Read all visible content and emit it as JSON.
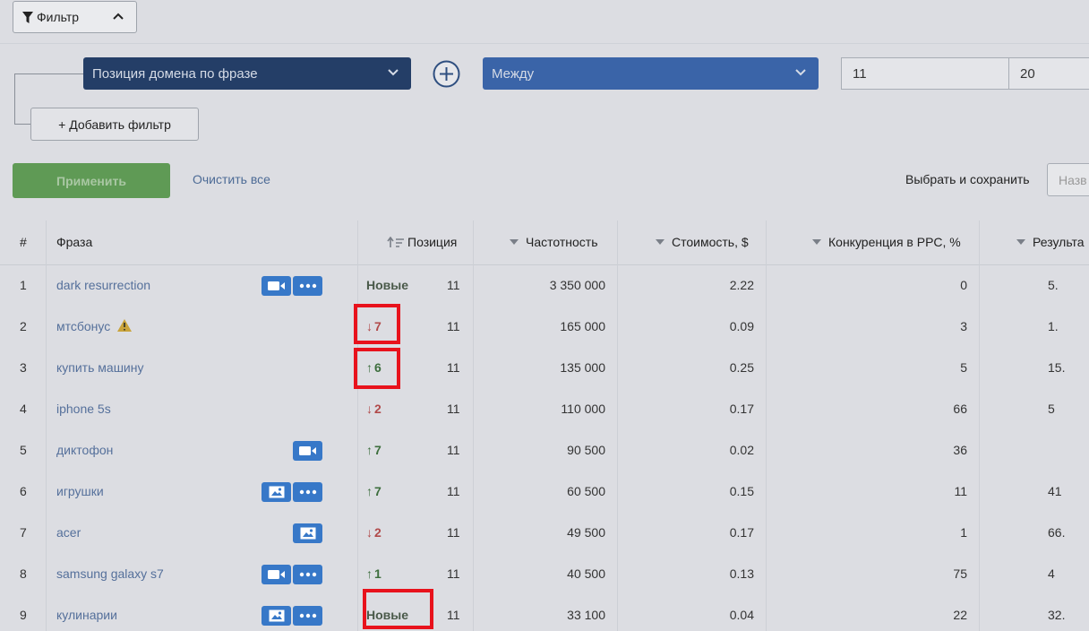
{
  "filter": {
    "toggle_label": "Фильтр",
    "condition_field": "Позиция домена по фразе",
    "operator": "Между",
    "value_from": "11",
    "value_to": "20",
    "add_filter_label": "+ Добавить фильтр",
    "apply_label": "Применить",
    "clear_label": "Очистить все",
    "choose_save_label": "Выбрать и сохранить",
    "name_placeholder": "Назв"
  },
  "table": {
    "headers": {
      "num": "#",
      "phrase": "Фраза",
      "position": "Позиция",
      "frequency": "Частотность",
      "cost": "Стоимость, $",
      "competition": "Конкуренция в PPC, %",
      "results": "Результа"
    },
    "rows": [
      {
        "num": "1",
        "phrase": "dark resurrection",
        "change": "Новые",
        "change_type": "new",
        "position": "11",
        "frequency": "3 350 000",
        "cost": "2.22",
        "competition": "0",
        "results": "5.",
        "badges": [
          "video",
          "more"
        ]
      },
      {
        "num": "2",
        "phrase": "мтсбонус",
        "change": "7",
        "change_type": "down",
        "position": "11",
        "frequency": "165 000",
        "cost": "0.09",
        "competition": "3",
        "results": "1.",
        "badges": [],
        "warning": true
      },
      {
        "num": "3",
        "phrase": "купить машину",
        "change": "6",
        "change_type": "up",
        "position": "11",
        "frequency": "135 000",
        "cost": "0.25",
        "competition": "5",
        "results": "15.",
        "badges": []
      },
      {
        "num": "4",
        "phrase": "iphone 5s",
        "change": "2",
        "change_type": "down",
        "position": "11",
        "frequency": "110 000",
        "cost": "0.17",
        "competition": "66",
        "results": "5",
        "badges": []
      },
      {
        "num": "5",
        "phrase": "диктофон",
        "change": "7",
        "change_type": "up",
        "position": "11",
        "frequency": "90 500",
        "cost": "0.02",
        "competition": "36",
        "results": "",
        "badges": [
          "video"
        ]
      },
      {
        "num": "6",
        "phrase": "игрушки",
        "change": "7",
        "change_type": "up",
        "position": "11",
        "frequency": "60 500",
        "cost": "0.15",
        "competition": "11",
        "results": "41",
        "badges": [
          "image",
          "more"
        ]
      },
      {
        "num": "7",
        "phrase": "acer",
        "change": "2",
        "change_type": "down",
        "position": "11",
        "frequency": "49 500",
        "cost": "0.17",
        "competition": "1",
        "results": "66.",
        "badges": [
          "image"
        ]
      },
      {
        "num": "8",
        "phrase": "samsung galaxy s7",
        "change": "1",
        "change_type": "up",
        "position": "11",
        "frequency": "40 500",
        "cost": "0.13",
        "competition": "75",
        "results": "4",
        "badges": [
          "video",
          "more"
        ]
      },
      {
        "num": "9",
        "phrase": "кулинарии",
        "change": "Новые",
        "change_type": "new",
        "position": "11",
        "frequency": "33 100",
        "cost": "0.04",
        "competition": "22",
        "results": "32.",
        "badges": [
          "image",
          "more"
        ]
      }
    ]
  },
  "colors": {
    "highlight": "#e8121c",
    "badge": "#3778c8",
    "up": "#3d6e3d",
    "down": "#b14a4a"
  }
}
